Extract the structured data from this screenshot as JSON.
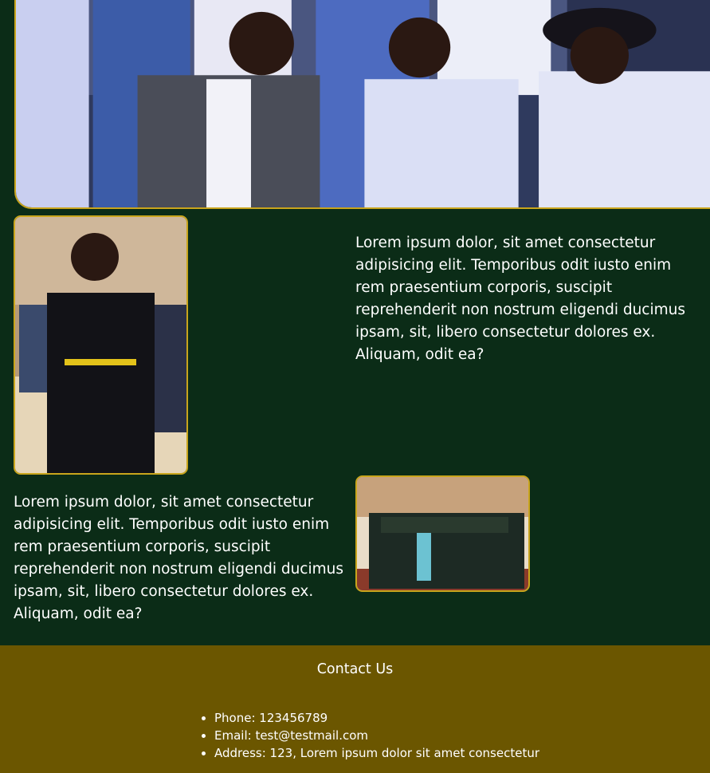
{
  "article": {
    "paragraph_1": "Lorem ipsum dolor, sit amet consectetur adipisicing elit. Temporibus odit iusto enim rem praesentium corporis, suscipit reprehenderit non nostrum eligendi ducimus ipsam, sit, libero consectetur dolores ex. Aliquam, odit ea?",
    "paragraph_2": "Lorem ipsum dolor, sit amet consectetur adipisicing elit. Temporibus odit iusto enim rem praesentium corporis, suscipit reprehenderit non nostrum eligendi ducimus ipsam, sit, libero consectetur dolores ex. Aliquam, odit ea?"
  },
  "footer": {
    "title": "Contact Us",
    "items": [
      "Phone: 123456789",
      "Email: test@testmail.com",
      "Address: 123, Lorem ipsum dolor sit amet consectetur"
    ]
  },
  "colors": {
    "background": "#0b2c17",
    "accent_border": "#c9a51c",
    "footer_background": "#6b5600"
  }
}
